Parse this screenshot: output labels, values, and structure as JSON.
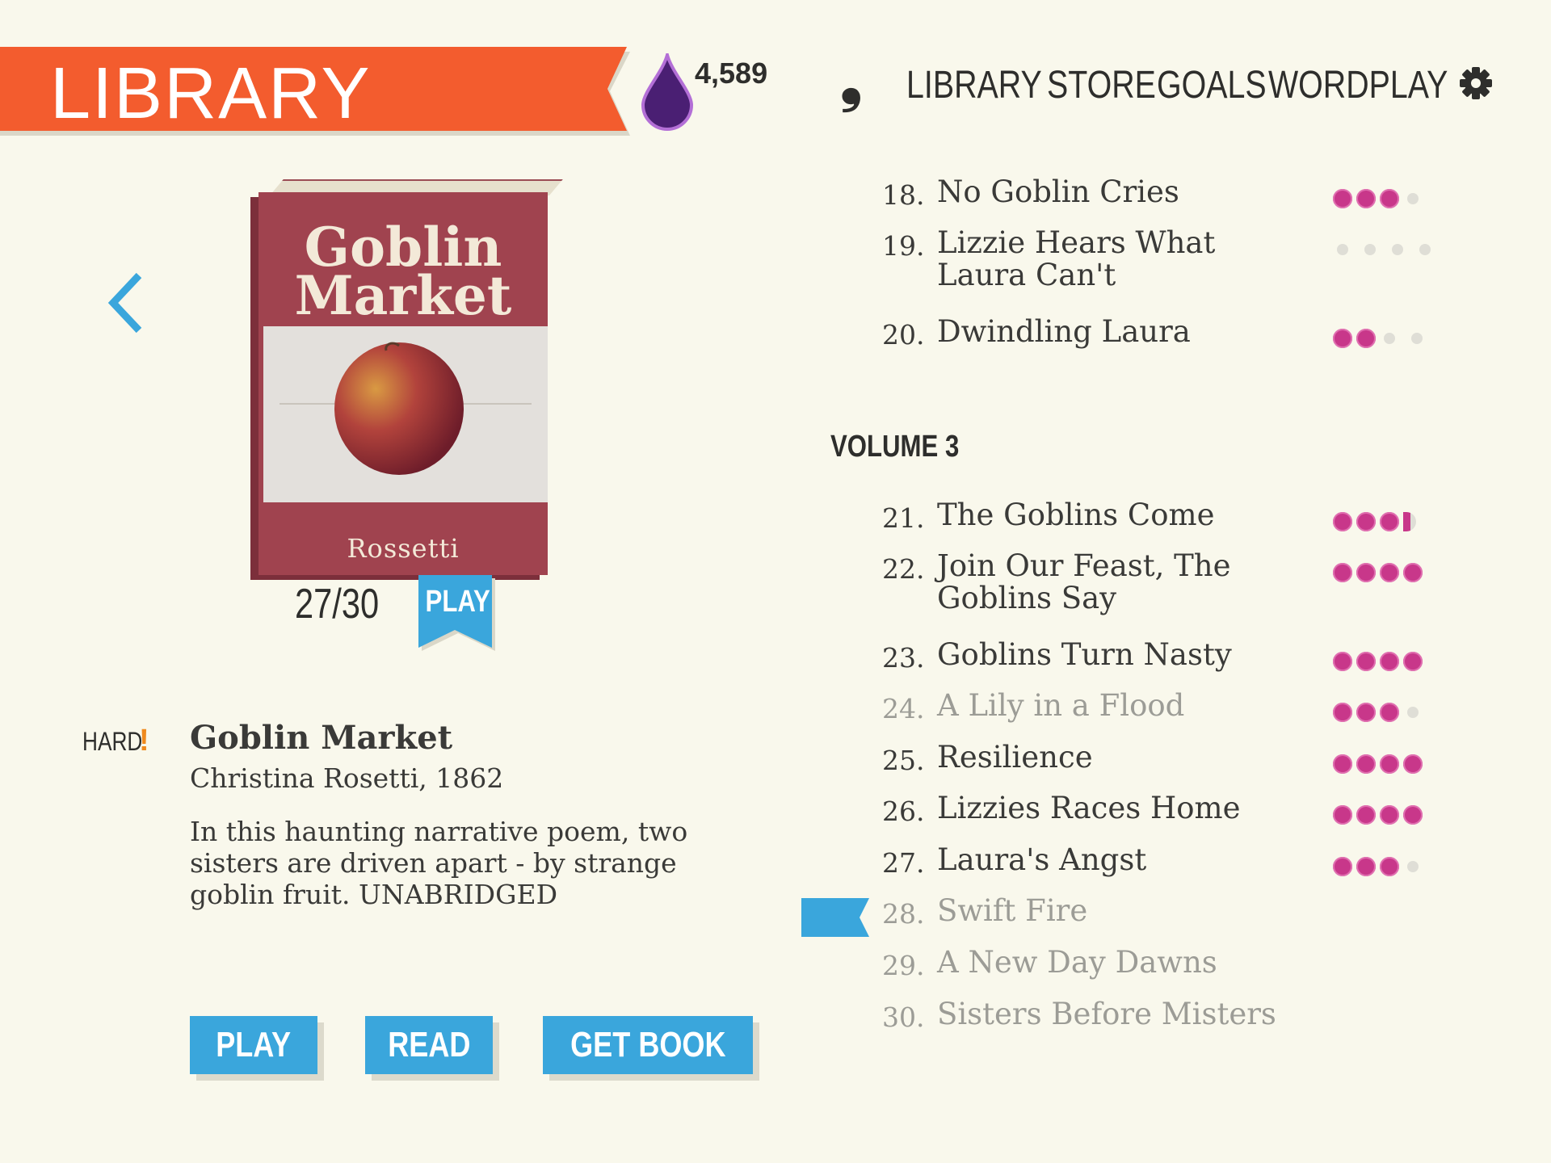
{
  "header": {
    "title": "LIBRARY",
    "ink_count": "4,589"
  },
  "nav": {
    "items": [
      "LIBRARY",
      "STORE",
      "GOALS",
      "WORDPLAY"
    ],
    "logo_glyph": "❟",
    "settings_icon": "gear-icon"
  },
  "book": {
    "cover_title": "Goblin Market",
    "cover_author": "Rossetti",
    "progress": "27/30",
    "play_ribbon_label": "PLAY",
    "difficulty": "HARD",
    "difficulty_mark": "!",
    "title": "Goblin Market",
    "author_line": "Christina  Rosetti, 1862",
    "description": "In this haunting narrative poem, two sisters are driven apart - by strange goblin fruit. UNABRIDGED"
  },
  "actions": {
    "play": "PLAY",
    "read": "READ",
    "get_book": "GET BOOK"
  },
  "volume_heading": "VOLUME 3",
  "colors": {
    "banner": "#f35c2e",
    "accent": "#3aa6dc",
    "dot_full": "#c8378a",
    "ink": "#4a1f73"
  },
  "chapters": [
    {
      "num": "18.",
      "title": "No Goblin Cries",
      "rating": 3,
      "partial": false,
      "locked": false
    },
    {
      "num": "19.",
      "title": "Lizzie Hears What Laura Can't",
      "rating": 0,
      "partial": false,
      "locked": false
    },
    {
      "num": "20.",
      "title": "Dwindling Laura",
      "rating": 2,
      "partial": false,
      "locked": false
    },
    {
      "num": "21.",
      "title": "The Goblins Come",
      "rating": 3,
      "partial": true,
      "locked": false
    },
    {
      "num": "22.",
      "title": "Join Our Feast, The Goblins Say",
      "rating": 4,
      "partial": false,
      "locked": false
    },
    {
      "num": "23.",
      "title": "Goblins Turn Nasty",
      "rating": 4,
      "partial": false,
      "locked": false
    },
    {
      "num": "24.",
      "title": "A Lily in a Flood",
      "rating": 3,
      "partial": false,
      "locked": true
    },
    {
      "num": "25.",
      "title": "Resilience",
      "rating": 4,
      "partial": false,
      "locked": false
    },
    {
      "num": "26.",
      "title": "Lizzies Races Home",
      "rating": 4,
      "partial": false,
      "locked": false
    },
    {
      "num": "27.",
      "title": "Laura's Angst",
      "rating": 3,
      "partial": false,
      "locked": false
    },
    {
      "num": "28.",
      "title": "Swift Fire",
      "rating": null,
      "partial": false,
      "locked": true,
      "current": true
    },
    {
      "num": "29.",
      "title": "A New Day Dawns",
      "rating": null,
      "partial": false,
      "locked": true
    },
    {
      "num": "30.",
      "title": "Sisters Before Misters",
      "rating": null,
      "partial": false,
      "locked": true
    }
  ]
}
